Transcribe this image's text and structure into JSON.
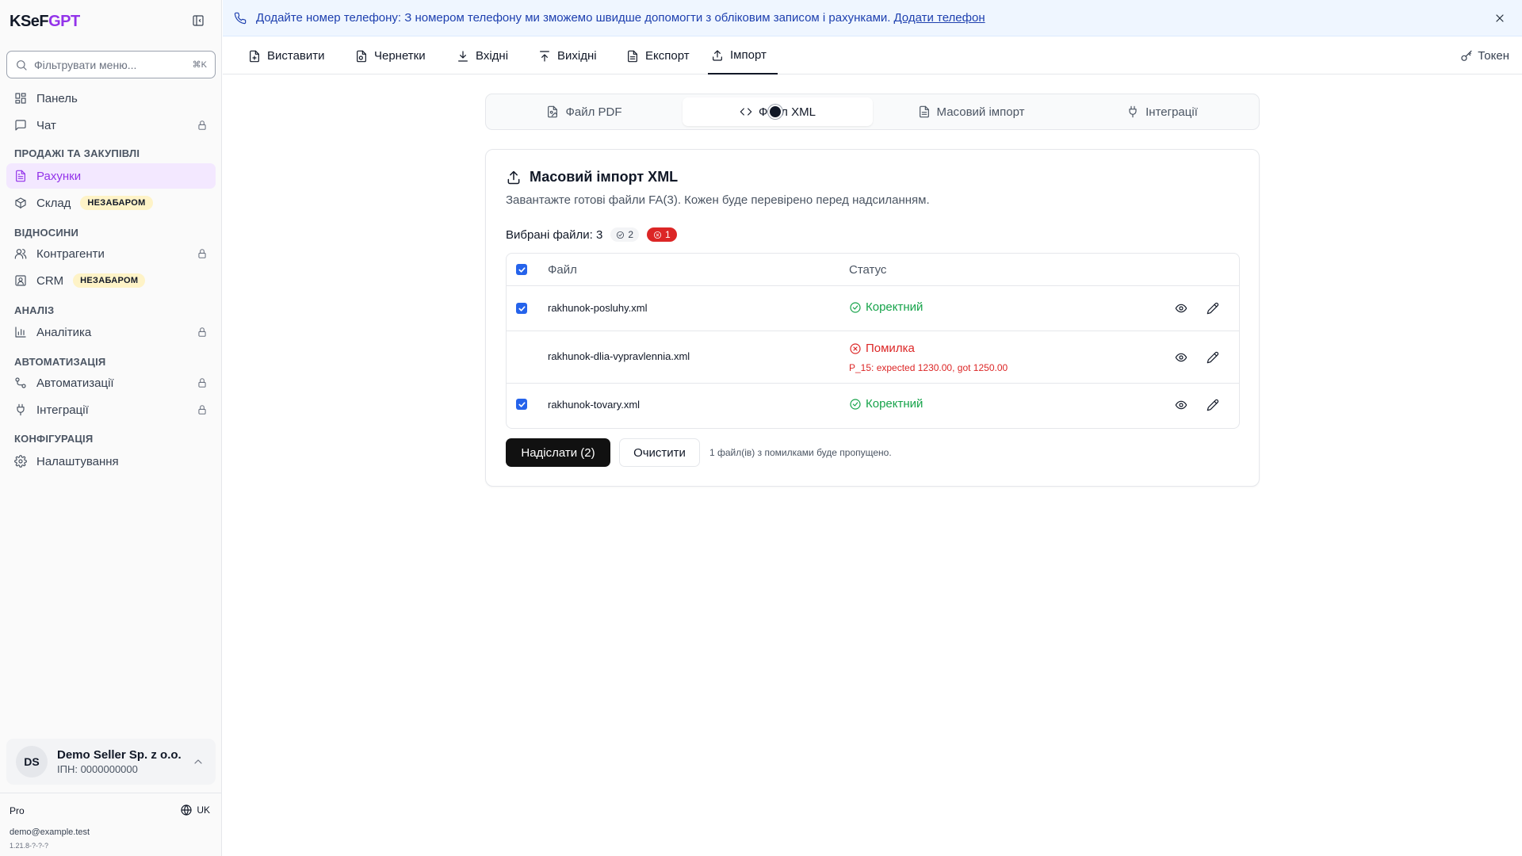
{
  "brand": {
    "part1": "KSeF",
    "part2": "GPT"
  },
  "sidebar": {
    "filter_placeholder": "Фільтрувати меню...",
    "filter_shortcut": "⌘K",
    "items": {
      "panel": "Панель",
      "chat": "Чат",
      "invoices": "Рахунки",
      "warehouse": "Склад",
      "contractors": "Контрагенти",
      "crm": "CRM",
      "analytics": "Аналітика",
      "automations": "Автоматизації",
      "integrations": "Інтеграції",
      "settings": "Налаштування"
    },
    "badge_soon": "НЕЗАБАРОМ",
    "sections": {
      "sales": "ПРОДАЖІ ТА ЗАКУПІВЛІ",
      "relations": "ВІДНОСИНИ",
      "analysis": "АНАЛІЗ",
      "automation": "АВТОМАТИЗАЦІЯ",
      "config": "КОНФІГУРАЦІЯ"
    },
    "account": {
      "initials": "DS",
      "name": "Demo Seller Sp. z o.o.",
      "tax_id": "ІПН: 0000000000"
    },
    "plan": "Pro",
    "language": "UK",
    "email": "demo@example.test",
    "version": "1.21.8-?-?-?"
  },
  "banner": {
    "text": "Додайте номер телефону: З номером телефону ми зможемо швидше допомогти з обліковим записом і рахунками.",
    "link": "Додати телефон"
  },
  "topnav": {
    "tabs": [
      "Виставити",
      "Чернетки",
      "Вхідні",
      "Вихідні",
      "Експорт",
      "Імпорт"
    ],
    "token": "Токен"
  },
  "segments": [
    "Файл PDF",
    "Файл XML",
    "Масовий імпорт",
    "Інтеграції"
  ],
  "card": {
    "title": "Масовий імпорт XML",
    "description": "Завантажте готові файли FA(3). Кожен буде перевірено перед надсиланням.",
    "selected_label": "Вибрані файли: 3",
    "ok_count": "2",
    "err_count": "1",
    "col_file": "Файл",
    "col_status": "Статус",
    "rows": [
      {
        "file": "rakhunok-posluhy.xml",
        "status": "Коректний",
        "error": ""
      },
      {
        "file": "rakhunok-dlia-vypravlennia.xml",
        "status": "Помилка",
        "error": "P_15: expected 1230.00, got 1250.00"
      },
      {
        "file": "rakhunok-tovary.xml",
        "status": "Коректний",
        "error": ""
      }
    ],
    "send_button": "Надіслати (2)",
    "clear_button": "Очистити",
    "skip_note": "1 файл(ів) з помилками буде пропущено."
  },
  "colors": {
    "accent": "#9333ea",
    "success": "#16a34a",
    "error": "#dc2626",
    "checkbox": "#2563eb",
    "banner_bg": "#eff6ff"
  }
}
